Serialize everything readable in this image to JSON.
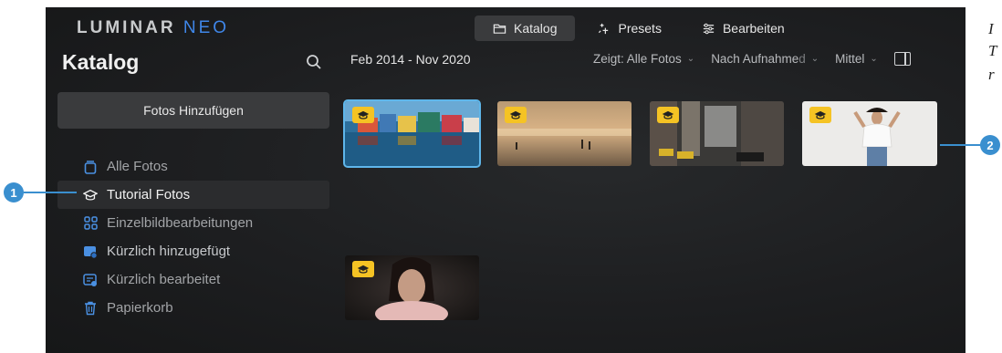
{
  "app": {
    "logo_main": "LUMINAR",
    "logo_accent": "NEO"
  },
  "top_tabs": [
    {
      "label": "Katalog",
      "icon": "folder-icon",
      "active": true
    },
    {
      "label": "Presets",
      "icon": "sparkle-icon",
      "active": false
    },
    {
      "label": "Bearbeiten",
      "icon": "sliders-icon",
      "active": false
    }
  ],
  "sidebar": {
    "title": "Katalog",
    "add_button": "Fotos Hinzufügen",
    "items": [
      {
        "label": "Alle Fotos",
        "icon": "photos-stack-icon"
      },
      {
        "label": "Tutorial Fotos",
        "icon": "graduation-cap-icon"
      },
      {
        "label": "Einzelbildbearbeitungen",
        "icon": "grid-icon"
      },
      {
        "label": "Kürzlich hinzugefügt",
        "icon": "recent-add-icon"
      },
      {
        "label": "Kürzlich bearbeitet",
        "icon": "recent-edit-icon"
      },
      {
        "label": "Papierkorb",
        "icon": "trash-icon"
      }
    ]
  },
  "toolbar": {
    "date_range": "Feb 2014 - Nov 2020",
    "show_filter": "Zeigt: Alle Fotos",
    "sort": "Nach Aufnahme",
    "sort_faded": "d",
    "size": "Mittel"
  },
  "thumbnails": [
    {
      "name": "harbor-houses",
      "selected": true
    },
    {
      "name": "beach-sunset",
      "selected": false
    },
    {
      "name": "city-street",
      "selected": false
    },
    {
      "name": "woman-white-shirt",
      "selected": false
    },
    {
      "name": "portrait-pink",
      "selected": false
    }
  ],
  "callouts": [
    "1",
    "2"
  ],
  "margin_text": [
    "I",
    "T",
    "r"
  ],
  "colors": {
    "accent": "#3a8fcf",
    "badge": "#f5c324",
    "selection": "#5fb6ea"
  }
}
